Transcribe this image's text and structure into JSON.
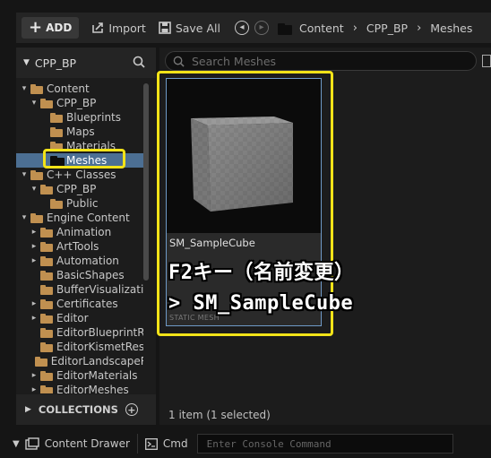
{
  "toolbar": {
    "add_label": "ADD",
    "import_label": "Import",
    "save_all_label": "Save All"
  },
  "breadcrumb": [
    "Content",
    "CPP_BP",
    "Meshes"
  ],
  "left_panel": {
    "title": "CPP_BP",
    "tree": [
      {
        "label": "Content",
        "depth": 0,
        "expanded": true,
        "type": "folder"
      },
      {
        "label": "CPP_BP",
        "depth": 1,
        "expanded": true,
        "type": "folder"
      },
      {
        "label": "Blueprints",
        "depth": 2,
        "expanded": false,
        "type": "folder"
      },
      {
        "label": "Maps",
        "depth": 2,
        "expanded": false,
        "type": "folder"
      },
      {
        "label": "Materials",
        "depth": 2,
        "expanded": false,
        "type": "folder"
      },
      {
        "label": "Meshes",
        "depth": 2,
        "expanded": false,
        "type": "folder",
        "selected": true
      },
      {
        "label": "C++ Classes",
        "depth": 0,
        "expanded": true,
        "type": "class"
      },
      {
        "label": "CPP_BP",
        "depth": 1,
        "expanded": true,
        "type": "class"
      },
      {
        "label": "Public",
        "depth": 2,
        "expanded": false,
        "type": "class"
      },
      {
        "label": "Engine Content",
        "depth": 0,
        "expanded": true,
        "type": "folder"
      },
      {
        "label": "Animation",
        "depth": 1,
        "expanded": false,
        "type": "folder",
        "has_children": true
      },
      {
        "label": "ArtTools",
        "depth": 1,
        "expanded": false,
        "type": "folder",
        "has_children": true
      },
      {
        "label": "Automation",
        "depth": 1,
        "expanded": false,
        "type": "folder",
        "has_children": true
      },
      {
        "label": "BasicShapes",
        "depth": 1,
        "expanded": false,
        "type": "folder"
      },
      {
        "label": "BufferVisualization",
        "depth": 1,
        "expanded": false,
        "type": "folder"
      },
      {
        "label": "Certificates",
        "depth": 1,
        "expanded": false,
        "type": "folder",
        "has_children": true
      },
      {
        "label": "Editor",
        "depth": 1,
        "expanded": false,
        "type": "folder",
        "has_children": true
      },
      {
        "label": "EditorBlueprintResources",
        "depth": 1,
        "expanded": false,
        "type": "folder"
      },
      {
        "label": "EditorKismetResources",
        "depth": 1,
        "expanded": false,
        "type": "folder"
      },
      {
        "label": "EditorLandscapeResources",
        "depth": 1,
        "expanded": false,
        "type": "folder"
      },
      {
        "label": "EditorMaterials",
        "depth": 1,
        "expanded": false,
        "type": "folder",
        "has_children": true
      },
      {
        "label": "EditorMeshes",
        "depth": 1,
        "expanded": false,
        "type": "folder",
        "has_children": true
      }
    ],
    "collections_label": "COLLECTIONS"
  },
  "content": {
    "search_placeholder": "Search Meshes",
    "asset": {
      "name": "SM_SampleCube",
      "type_label": "STATIC MESH"
    },
    "status": "1 item (1 selected)"
  },
  "bottom_bar": {
    "content_drawer_label": "Content Drawer",
    "cmd_label": "Cmd",
    "console_placeholder": "Enter Console Command"
  },
  "annotation": {
    "line1": "F2キー（名前変更）",
    "line2": "> SM_SampleCube",
    "color": "#f2e318"
  }
}
